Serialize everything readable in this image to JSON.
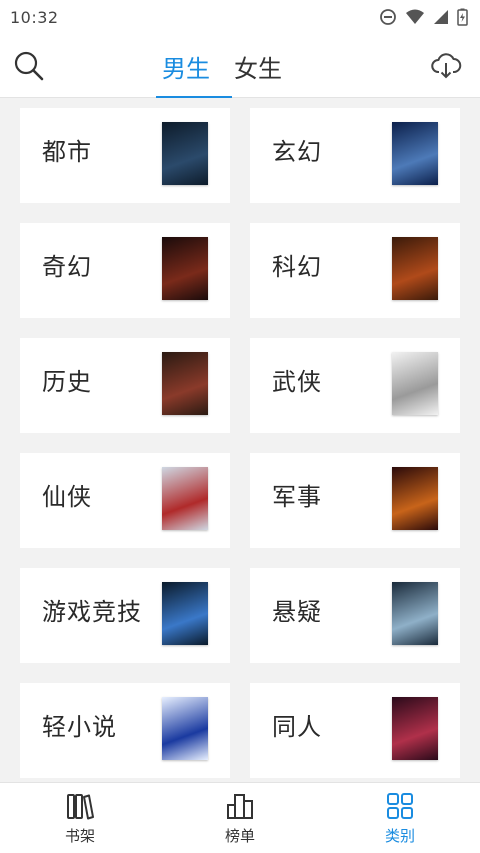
{
  "status": {
    "time": "10:32"
  },
  "header": {
    "tabs": [
      {
        "label": "男生",
        "active": true
      },
      {
        "label": "女生",
        "active": false
      }
    ]
  },
  "categories": [
    {
      "label": "都市",
      "cover_colors": [
        "#0d1b2a",
        "#2b4a6b"
      ]
    },
    {
      "label": "玄幻",
      "cover_colors": [
        "#0b1f4a",
        "#4d7ab8"
      ]
    },
    {
      "label": "奇幻",
      "cover_colors": [
        "#1a0b0b",
        "#7a2a1a"
      ]
    },
    {
      "label": "科幻",
      "cover_colors": [
        "#3a1a0a",
        "#b04a1a"
      ]
    },
    {
      "label": "历史",
      "cover_colors": [
        "#2a1a12",
        "#8a3a2a"
      ]
    },
    {
      "label": "武侠",
      "cover_colors": [
        "#f2f2f2",
        "#9a9a9a"
      ]
    },
    {
      "label": "仙侠",
      "cover_colors": [
        "#cfd8e3",
        "#b02a2a"
      ]
    },
    {
      "label": "军事",
      "cover_colors": [
        "#2a0a0a",
        "#c8641a"
      ]
    },
    {
      "label": "游戏竞技",
      "cover_colors": [
        "#0a1a2a",
        "#3a78c8"
      ]
    },
    {
      "label": "悬疑",
      "cover_colors": [
        "#1a2a3a",
        "#8fb0c8"
      ]
    },
    {
      "label": "轻小说",
      "cover_colors": [
        "#e8f0ff",
        "#1a3aa0"
      ]
    },
    {
      "label": "同人",
      "cover_colors": [
        "#2a0a1a",
        "#b0304a"
      ]
    }
  ],
  "bottom_nav": [
    {
      "label": "书架",
      "icon": "bookshelf-icon",
      "active": false
    },
    {
      "label": "榜单",
      "icon": "ranking-icon",
      "active": false
    },
    {
      "label": "类别",
      "icon": "category-icon",
      "active": true
    }
  ],
  "colors": {
    "accent": "#1a8ce0",
    "background": "#f2f2f2"
  }
}
